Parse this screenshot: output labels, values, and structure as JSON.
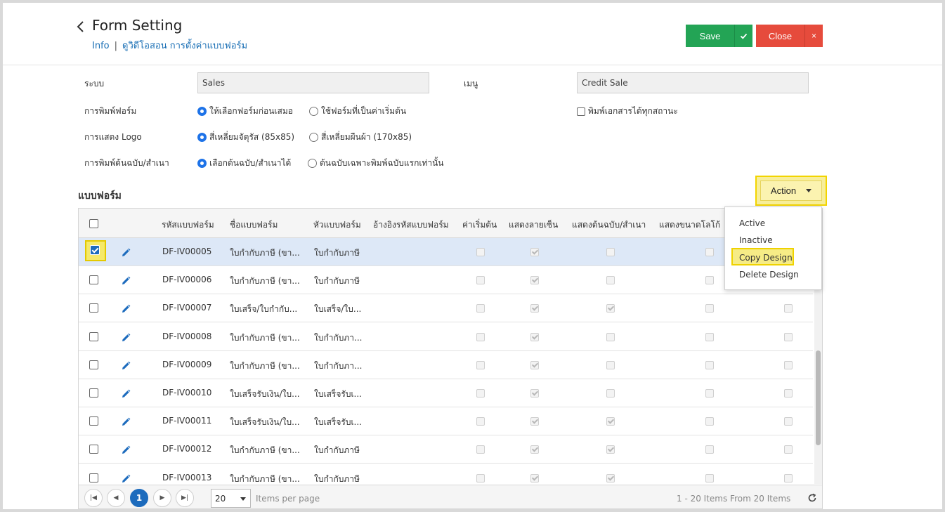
{
  "header": {
    "title": "Form Setting",
    "breadcrumb": {
      "info": "Info",
      "separator": "|",
      "path": "ดูวิดีโอสอน การตั้งค่าแบบฟอร์ม"
    },
    "save_label": "Save",
    "close_label": "Close",
    "close_icon": "×"
  },
  "form": {
    "system_label": "ระบบ",
    "system_value": "Sales",
    "menu_label": "เมนู",
    "menu_value": "Credit Sale",
    "print_form_label": "การพิมพ์ฟอร์ม",
    "print_form_opt1": "ให้เลือกฟอร์มก่อนเสมอ",
    "print_form_opt2": "ใช้ฟอร์มที่เป็นค่าเริ่มต้น",
    "print_all_status": "พิมพ์เอกสารได้ทุกสถานะ",
    "logo_label": "การแสดง Logo",
    "logo_opt1": "สี่เหลี่ยมจัตุรัส (85x85)",
    "logo_opt2": "สี่เหลี่ยมผืนผ้า (170x85)",
    "copy_label": "การพิมพ์ต้นฉบับ/สำเนา",
    "copy_opt1": "เลือกต้นฉบับ/สำเนาได้",
    "copy_opt2": "ต้นฉบับเฉพาะพิมพ์ฉบับแรกเท่านั้น"
  },
  "section_title": "แบบฟอร์ม",
  "action_label": "Action",
  "action_menu": [
    "Active",
    "Inactive",
    "Copy Design",
    "Delete Design"
  ],
  "table": {
    "columns": [
      "รหัสแบบฟอร์ม",
      "ชื่อแบบฟอร์ม",
      "หัวแบบฟอร์ม",
      "อ้างอิงรหัสแบบฟอร์ม",
      "ค่าเริ่มต้น",
      "แสดงลายเซ็น",
      "แสดงต้นฉบับ/สำเนา",
      "แสดงขนาดโลโก้"
    ],
    "rows": [
      {
        "code": "DF-IV00005",
        "name": "ใบกำกับภาษี (ขา...",
        "head": "ใบกำกับภาษี",
        "flags": [
          false,
          true,
          false,
          false,
          false
        ],
        "selected": true
      },
      {
        "code": "DF-IV00006",
        "name": "ใบกำกับภาษี (ขา...",
        "head": "ใบกำกับภาษี",
        "flags": [
          false,
          true,
          false,
          false,
          false
        ],
        "selected": false
      },
      {
        "code": "DF-IV00007",
        "name": "ใบเสร็จ/ใบกำกับ...",
        "head": "ใบเสร็จ/ใบ...",
        "flags": [
          false,
          true,
          true,
          false,
          false
        ],
        "selected": false
      },
      {
        "code": "DF-IV00008",
        "name": "ใบกำกับภาษี (ขา...",
        "head": "ใบกำกับภา...",
        "flags": [
          false,
          true,
          false,
          false,
          false
        ],
        "selected": false
      },
      {
        "code": "DF-IV00009",
        "name": "ใบกำกับภาษี (ขา...",
        "head": "ใบกำกับภา...",
        "flags": [
          false,
          true,
          false,
          false,
          false
        ],
        "selected": false
      },
      {
        "code": "DF-IV00010",
        "name": "ใบเสร็จรับเงิน/ใบ...",
        "head": "ใบเสร็จรับเ...",
        "flags": [
          false,
          true,
          false,
          false,
          false
        ],
        "selected": false
      },
      {
        "code": "DF-IV00011",
        "name": "ใบเสร็จรับเงิน/ใบ...",
        "head": "ใบเสร็จรับเ...",
        "flags": [
          false,
          true,
          true,
          false,
          false
        ],
        "selected": false
      },
      {
        "code": "DF-IV00012",
        "name": "ใบกำกับภาษี (ขา...",
        "head": "ใบกำกับภาษี",
        "flags": [
          false,
          true,
          true,
          false,
          false
        ],
        "selected": false
      },
      {
        "code": "DF-IV00013",
        "name": "ใบกำกับภาษี (ขา...",
        "head": "ใบกำกับภาษี",
        "flags": [
          false,
          true,
          true,
          false,
          false
        ],
        "selected": false
      }
    ]
  },
  "pager": {
    "current": "1",
    "page_size": "20",
    "items_per_page": "Items per page",
    "summary": "1 - 20 Items From 20 Items"
  },
  "icons": {
    "back": "chevron-left-icon",
    "save": "check-icon",
    "edit": "pencil-icon",
    "refresh": "refresh-icon"
  },
  "colors": {
    "save": "#23a455",
    "close": "#e64b3c",
    "accent": "#1c6bbd",
    "highlight": "#f6ec86"
  }
}
